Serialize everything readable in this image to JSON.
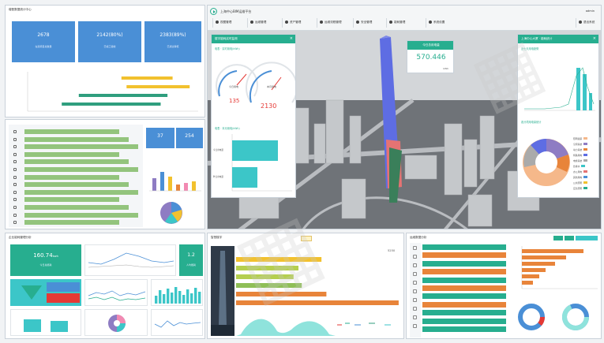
{
  "top_left": {
    "title": "增配数据统计中心",
    "stats": [
      {
        "value": "2678",
        "label": "在建项目总数量"
      },
      {
        "value": "2142(80%)",
        "label": "已竣工验收"
      },
      {
        "value": "2383(89%)",
        "label": "已通过审核"
      }
    ]
  },
  "mid_left": {
    "cards": [
      {
        "value": "37"
      },
      {
        "value": "254"
      }
    ]
  },
  "bottom_left": {
    "title": "企业能耗管理分析",
    "big_stat": {
      "value": "160.74",
      "unit": "kwh",
      "label": "今日总能耗"
    },
    "small_stat": {
      "value": "1.2",
      "label": "人均能耗"
    }
  },
  "bottom_mid": {
    "title": "智慧楼宇",
    "badge": "5250"
  },
  "bottom_right": {
    "title": "运维数据分析"
  },
  "scene": {
    "app_title": "上海中心BIM运维平台",
    "user_label": "admin",
    "nav": [
      "视图管理",
      "运维管理",
      "资产管理",
      "运维流程管理",
      "安全管理",
      "能耗管理",
      "系统设置"
    ],
    "exit_label": "退出系统",
    "energy_panel": {
      "title": "楼宇能耗实时监测",
      "sub1": "电表 · 实时用电(kWh)",
      "gauge_left": "135",
      "gauge_right": "2130",
      "gauge_left_cap": "今日用电",
      "gauge_right_cap": "本月用电",
      "sub2": "电表 · 本月用电(kWh)",
      "bar_label_1": "今日用电量",
      "bar_label_2": "昨日用电量"
    },
    "today_card": {
      "title": "今日总用电量",
      "value": "570.446",
      "unit": "kWh"
    },
    "right_panel": {
      "title": "上海中心大厦 · 能耗统计",
      "sub1": "近七天用电趋势",
      "sub2": "各分项用电量统计",
      "legend": [
        "照明插座",
        "空调系统",
        "动力系统",
        "特殊用电",
        "电梯系统",
        "给排水",
        "办公用电",
        "其他用电",
        "公共照明",
        "应急照明"
      ]
    }
  },
  "colors": {
    "blue_card": "#4a8fd6",
    "green": "#27ae8f",
    "teal": "#3cc6c8",
    "orange": "#e8843a",
    "tower_blue": "#5e6de3",
    "gauge_red": "#e53935"
  },
  "top_left_chart": {
    "type": "bar",
    "bars": [
      {
        "start": 0.55,
        "end": 0.85,
        "color": "#f2c12e"
      },
      {
        "start": 0.58,
        "end": 0.95,
        "color": "#f2c12e"
      },
      {
        "start": 0.3,
        "end": 0.82,
        "color": "#2f9e7e"
      },
      {
        "start": 0.2,
        "end": 0.78,
        "color": "#2f9e7e"
      }
    ]
  },
  "bottom_mid_chart": {
    "type": "bar",
    "bars": [
      {
        "value": 0.52,
        "color": "#f2c12e"
      },
      {
        "value": 0.38,
        "color": "#b5cf4f"
      },
      {
        "value": 0.35,
        "color": "#b5cf4f"
      },
      {
        "value": 0.4,
        "color": "#8fbf57"
      },
      {
        "value": 0.55,
        "color": "#e8843a"
      },
      {
        "value": 0.99,
        "color": "#e8843a"
      }
    ]
  }
}
